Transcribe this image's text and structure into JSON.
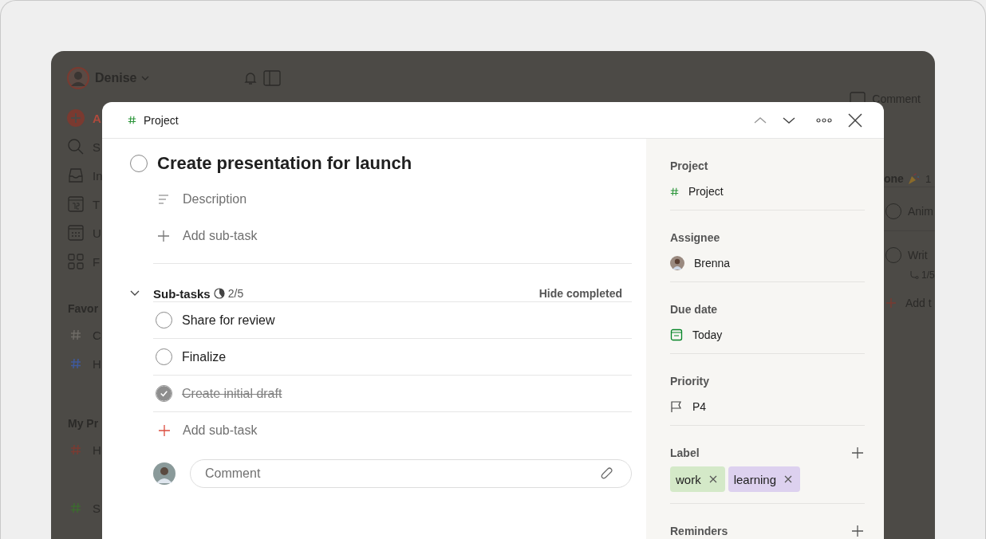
{
  "app": {
    "user": "Denise",
    "comment_button": "Comment",
    "sidebar": [
      {
        "kind": "add",
        "label": "A"
      },
      {
        "kind": "search",
        "label": "S"
      },
      {
        "kind": "inbox",
        "label": "In"
      },
      {
        "kind": "today",
        "label": "T"
      },
      {
        "kind": "upcoming",
        "label": "U"
      },
      {
        "kind": "filters",
        "label": "F"
      }
    ],
    "favorites_heading": "Favor",
    "favorites": [
      {
        "label": "C",
        "color": "#6e6b66"
      },
      {
        "label": "H",
        "color": "#3f5a9c"
      }
    ],
    "projects_heading": "My Pr",
    "projects": [
      {
        "label": "H",
        "color": "#7a3b32"
      },
      {
        "label": "S",
        "color": "#3d6a30"
      }
    ],
    "section": {
      "title": "one",
      "count": "1"
    },
    "tasks": [
      {
        "title": "Anim",
        "checked": false
      },
      {
        "title": "Writ",
        "checked": false,
        "subtasks": "1/5"
      }
    ],
    "add_task": "Add t"
  },
  "task": {
    "breadcrumb": "Project",
    "title": "Create presentation for launch",
    "checked": false,
    "description_placeholder": "Description",
    "add_subtask": "Add sub-task",
    "subtasks_heading": "Sub-tasks",
    "progress": {
      "text": "2/5"
    },
    "hide_completed": "Hide completed",
    "subtasks": [
      {
        "title": "Share for review",
        "checked": false
      },
      {
        "title": "Finalize",
        "checked": false
      },
      {
        "title": "Create initial draft",
        "checked": true
      }
    ],
    "add_subtask_bottom": "Add sub-task",
    "comment_placeholder": "Comment"
  },
  "details": {
    "project_label": "Project",
    "project": "Project",
    "assignee_label": "Assignee",
    "assignee": "Brenna",
    "due_label": "Due date",
    "due": "Today",
    "priority_label": "Priority",
    "priority": "P4",
    "label_label": "Label",
    "labels": [
      {
        "name": "work",
        "color": "#d4e9c8"
      },
      {
        "name": "learning",
        "color": "#ddd1ef"
      }
    ],
    "reminders_label": "Reminders"
  }
}
